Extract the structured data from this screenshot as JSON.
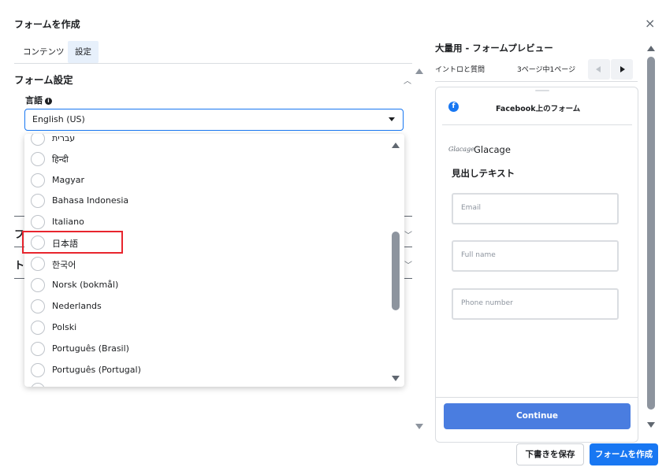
{
  "dialog": {
    "title": "フォームを作成",
    "close_icon": "×"
  },
  "tabs": [
    {
      "label": "コンテンツ"
    },
    {
      "label": "設定",
      "active": true
    }
  ],
  "form_settings": {
    "title": "フォーム設定",
    "language_label": "言語",
    "info_icon": "i",
    "selected_language": "English (US)"
  },
  "hidden_sections": {
    "row1_initial": "フ",
    "row2_initial": "ト"
  },
  "language_options": [
    "עברית",
    "हिन्दी",
    "Magyar",
    "Bahasa Indonesia",
    "Italiano",
    "日本語",
    "한국어",
    "Norsk (bokmål)",
    "Nederlands",
    "Polski",
    "Português (Brasil)",
    "Português (Portugal)"
  ],
  "preview": {
    "title": "大量用 - フォームプレビュー",
    "section": "イントロと質問",
    "page_indicator": "3ページ中1ページ",
    "platform_title": "Facebook上のフォーム",
    "fb_icon": "f",
    "brand_logo_text": "Glacage",
    "brand_name": "Glacage",
    "headline": "見出しテキスト",
    "fields": [
      {
        "placeholder": "Email"
      },
      {
        "placeholder": "Full name"
      },
      {
        "placeholder": "Phone number"
      }
    ],
    "continue_label": "Continue"
  },
  "footer": {
    "save_draft": "下書きを保存",
    "create": "フォームを作成"
  },
  "colors": {
    "accent": "#1877f2",
    "highlight": "#e8252e",
    "continue": "#4a7de0"
  }
}
